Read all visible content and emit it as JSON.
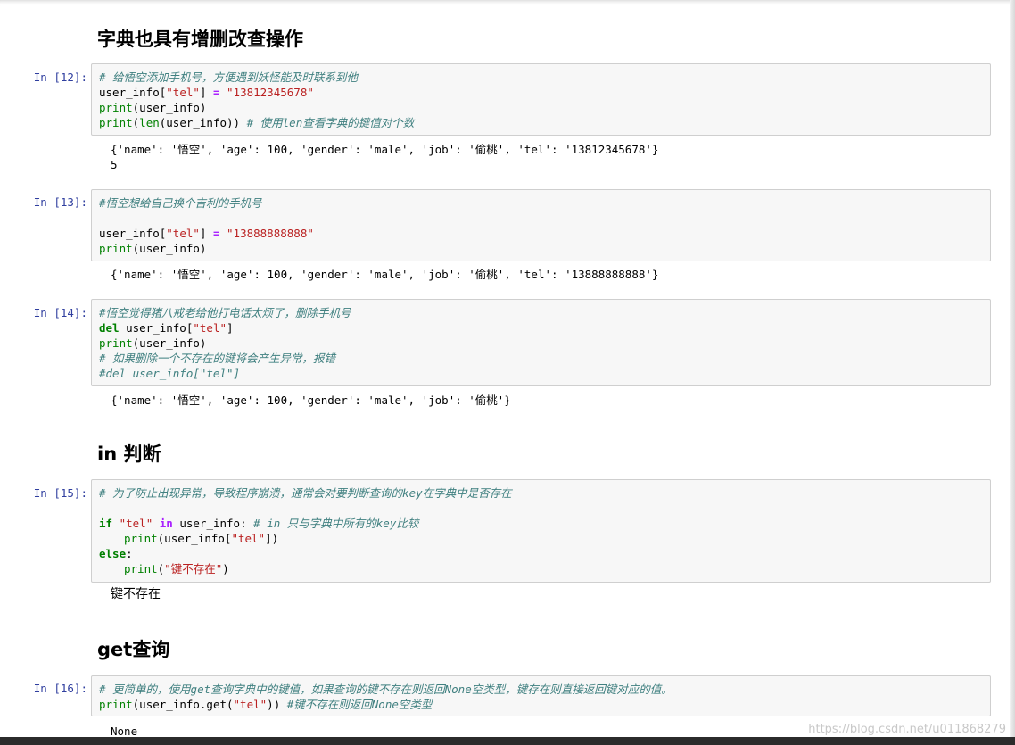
{
  "sections": {
    "crud_heading": "字典也具有增删改查操作",
    "in_heading": "in 判断",
    "get_heading": "get查询"
  },
  "cells": [
    {
      "prompt": "In  [12]:",
      "lines": [
        [
          {
            "t": "# 给悟空添加手机号，方便遇到妖怪能及时联系到他",
            "c": "comment"
          }
        ],
        [
          {
            "t": "user_info[",
            "c": "plain"
          },
          {
            "t": "\"tel\"",
            "c": "string"
          },
          {
            "t": "] ",
            "c": "plain"
          },
          {
            "t": "=",
            "c": "op"
          },
          {
            "t": " ",
            "c": "plain"
          },
          {
            "t": "\"13812345678\"",
            "c": "string"
          }
        ],
        [
          {
            "t": "print",
            "c": "builtin"
          },
          {
            "t": "(user_info)",
            "c": "plain"
          }
        ],
        [
          {
            "t": "print",
            "c": "builtin"
          },
          {
            "t": "(",
            "c": "plain"
          },
          {
            "t": "len",
            "c": "builtin"
          },
          {
            "t": "(user_info)) ",
            "c": "plain"
          },
          {
            "t": "# 使用len查看字典的键值对个数",
            "c": "comment"
          }
        ]
      ],
      "output": [
        "{'name': '悟空', 'age': 100, 'gender': 'male', 'job': '偷桃', 'tel': '13812345678'}",
        "5"
      ]
    },
    {
      "prompt": "In  [13]:",
      "lines": [
        [
          {
            "t": "#悟空想给自己换个吉利的手机号",
            "c": "comment"
          }
        ],
        [],
        [
          {
            "t": "user_info[",
            "c": "plain"
          },
          {
            "t": "\"tel\"",
            "c": "string"
          },
          {
            "t": "] ",
            "c": "plain"
          },
          {
            "t": "=",
            "c": "op"
          },
          {
            "t": " ",
            "c": "plain"
          },
          {
            "t": "\"13888888888\"",
            "c": "string"
          }
        ],
        [
          {
            "t": "print",
            "c": "builtin"
          },
          {
            "t": "(user_info)",
            "c": "plain"
          }
        ]
      ],
      "output": [
        "{'name': '悟空', 'age': 100, 'gender': 'male', 'job': '偷桃', 'tel': '13888888888'}"
      ]
    },
    {
      "prompt": "In  [14]:",
      "lines": [
        [
          {
            "t": "#悟空觉得猪八戒老给他打电话太烦了，删除手机号",
            "c": "comment"
          }
        ],
        [
          {
            "t": "del",
            "c": "keyword"
          },
          {
            "t": " user_info[",
            "c": "plain"
          },
          {
            "t": "\"tel\"",
            "c": "string"
          },
          {
            "t": "]",
            "c": "plain"
          }
        ],
        [
          {
            "t": "print",
            "c": "builtin"
          },
          {
            "t": "(user_info)",
            "c": "plain"
          }
        ],
        [
          {
            "t": "# 如果删除一个不存在的键将会产生异常，报错",
            "c": "comment"
          }
        ],
        [
          {
            "t": "#del user_info[\"tel\"]",
            "c": "comment"
          }
        ]
      ],
      "output": [
        "{'name': '悟空', 'age': 100, 'gender': 'male', 'job': '偷桃'}"
      ]
    },
    {
      "prompt": "In  [15]:",
      "lines": [
        [
          {
            "t": "# 为了防止出现异常，导致程序崩溃，通常会对要判断查询的key在字典中是否存在",
            "c": "comment"
          }
        ],
        [],
        [
          {
            "t": "if",
            "c": "keyword"
          },
          {
            "t": " ",
            "c": "plain"
          },
          {
            "t": "\"tel\"",
            "c": "string"
          },
          {
            "t": " ",
            "c": "plain"
          },
          {
            "t": "in",
            "c": "op"
          },
          {
            "t": " user_info: ",
            "c": "plain"
          },
          {
            "t": "# in 只与字典中所有的key比较",
            "c": "comment"
          }
        ],
        [
          {
            "t": "print",
            "c": "builtin",
            "indent": true
          },
          {
            "t": "(user_info[",
            "c": "plain"
          },
          {
            "t": "\"tel\"",
            "c": "string"
          },
          {
            "t": "])",
            "c": "plain"
          }
        ],
        [
          {
            "t": "else",
            "c": "keyword"
          },
          {
            "t": ":",
            "c": "plain"
          }
        ],
        [
          {
            "t": "print",
            "c": "builtin",
            "indent": true
          },
          {
            "t": "(",
            "c": "plain"
          },
          {
            "t": "\"键不存在\"",
            "c": "string"
          },
          {
            "t": ")",
            "c": "plain"
          }
        ]
      ],
      "output": [
        "键不存在"
      ]
    },
    {
      "prompt": "In  [16]:",
      "lines": [
        [
          {
            "t": "# 更简单的，使用get查询字典中的键值，如果查询的键不存在则返回None空类型，键存在则直接返回键对应的值。",
            "c": "comment"
          }
        ],
        [
          {
            "t": "print",
            "c": "builtin"
          },
          {
            "t": "(user_info.get(",
            "c": "plain"
          },
          {
            "t": "\"tel\"",
            "c": "string"
          },
          {
            "t": ")) ",
            "c": "plain"
          },
          {
            "t": "#键不存在则返回None空类型",
            "c": "comment"
          }
        ]
      ],
      "output": [
        "None"
      ]
    }
  ],
  "watermark": "https://blog.csdn.net/u011868279"
}
